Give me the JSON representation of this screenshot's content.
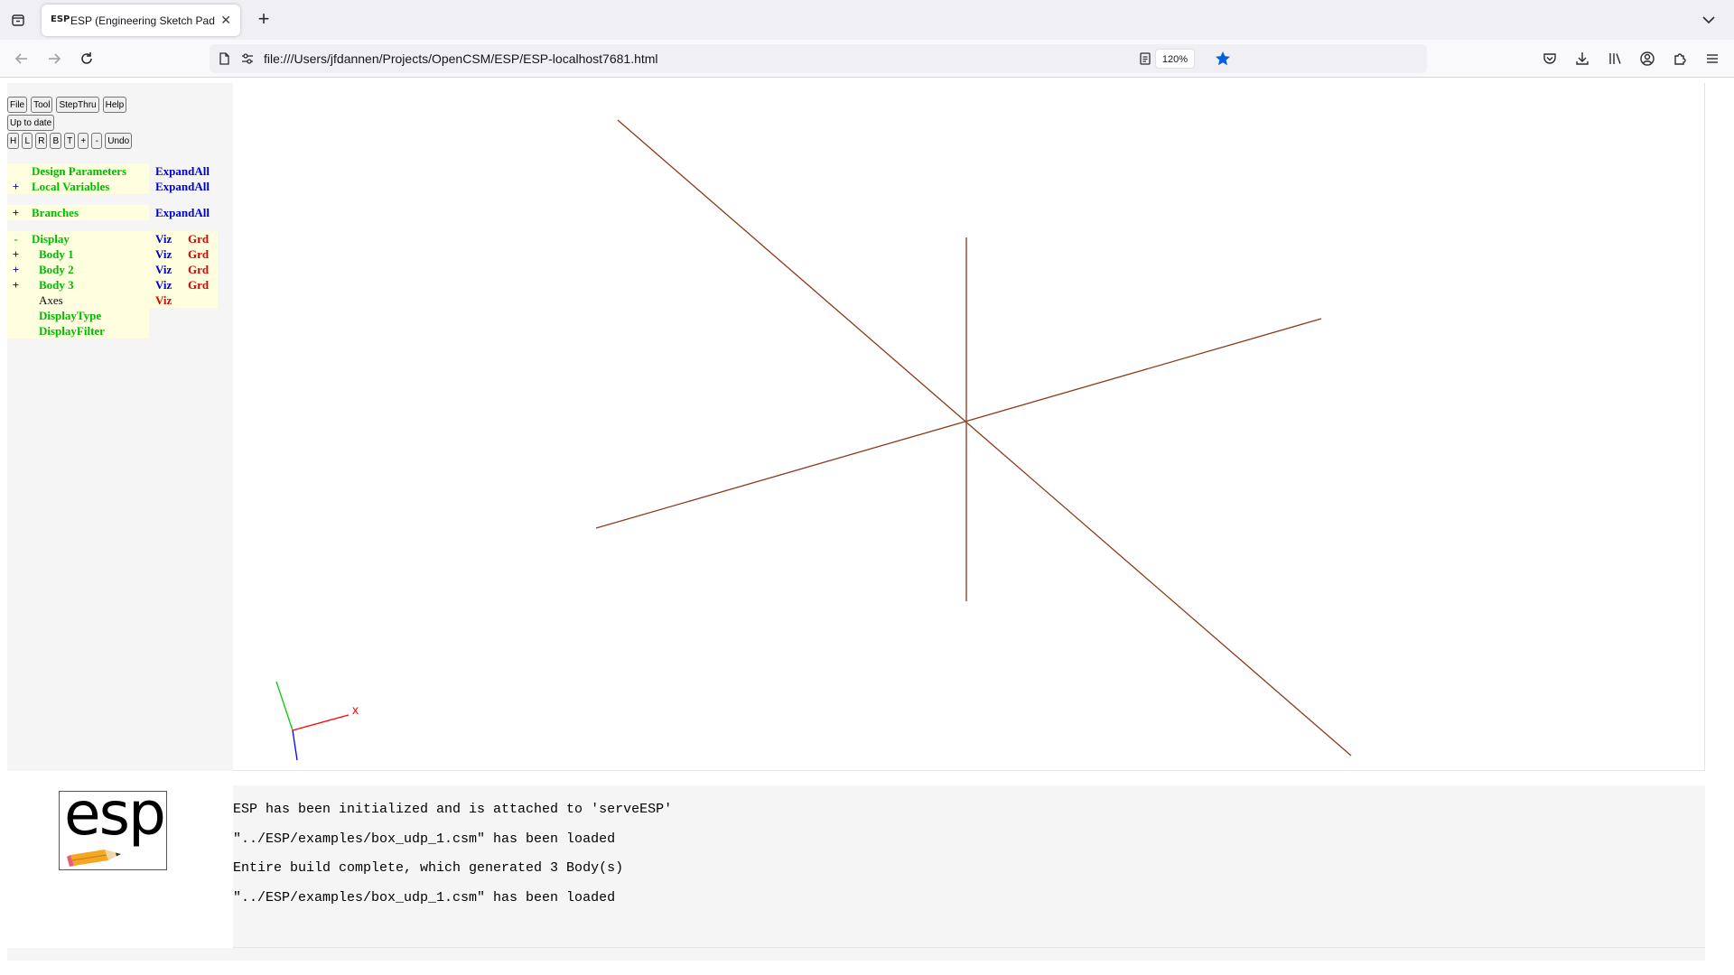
{
  "browser": {
    "tab_title": "ESP (Engineering Sketch Pad, V",
    "favicon_text": "ESP",
    "url": "file:///Users/jfdannen/Projects/OpenCSM/ESP/ESP-localhost7681.html",
    "zoom": "120%",
    "accent": "#0060df"
  },
  "toolbar": {
    "row1": [
      "File",
      "Tool",
      "StepThru",
      "Help"
    ],
    "status_button": "Up to date",
    "row3": [
      "H",
      "L",
      "R",
      "B",
      "T",
      "+",
      "-",
      "Undo"
    ]
  },
  "tree": [
    {
      "pm": "",
      "name": "Design Parameters",
      "a": "ExpandAll",
      "b": ""
    },
    {
      "pm": "+",
      "name": "Local Variables",
      "a": "ExpandAll",
      "b": ""
    },
    {
      "pm": "+",
      "name": "Branches",
      "a": "ExpandAll",
      "b": ""
    },
    {
      "pm": "-",
      "name": "Display",
      "a": "Viz",
      "b": "Grd"
    },
    {
      "pm": "+",
      "name": "Body 1",
      "a": "Viz",
      "b": "Grd"
    },
    {
      "pm": "+",
      "name": "Body 2",
      "a": "Viz",
      "b": "Grd"
    },
    {
      "pm": "+",
      "name": "Body 3",
      "a": "Viz",
      "b": "Grd"
    },
    {
      "pm": "",
      "name": "Axes",
      "a": "Viz",
      "b": ""
    },
    {
      "pm": "",
      "name": "DisplayType",
      "a": "",
      "b": ""
    },
    {
      "pm": "",
      "name": "DisplayFilter",
      "a": "",
      "b": ""
    }
  ],
  "graphics": {
    "axis_color": "#8b3a1a",
    "triad_x_label": "x",
    "triad_colors": {
      "x": "#ff0000",
      "y": "#00cc00",
      "z": "#0000ff"
    }
  },
  "logo": {
    "text": "esp"
  },
  "messages": [
    "ESP has been initialized and is attached to 'serveESP'",
    "\"../ESP/examples/box_udp_1.csm\" has been loaded",
    "Entire build complete, which generated 3 Body(s)",
    "\"../ESP/examples/box_udp_1.csm\" has been loaded"
  ]
}
